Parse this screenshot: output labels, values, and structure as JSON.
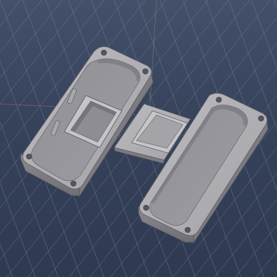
{
  "viewport": {
    "kind": "3d-model-viewport",
    "grid_visible": true,
    "background": [
      "#44506a",
      "#2f3a51"
    ],
    "grid_color": "#7e8aa4",
    "part_color": "#a9a9ad"
  },
  "parts": [
    {
      "name": "enclosure-base",
      "features": [
        "inner-cavity",
        "component-frame",
        "clips",
        "corner-mount-holes"
      ]
    },
    {
      "name": "cover-plate",
      "features": [
        "raised-window"
      ]
    },
    {
      "name": "enclosure-lid",
      "features": [
        "inner-cavity",
        "corner-mount-holes"
      ]
    }
  ]
}
